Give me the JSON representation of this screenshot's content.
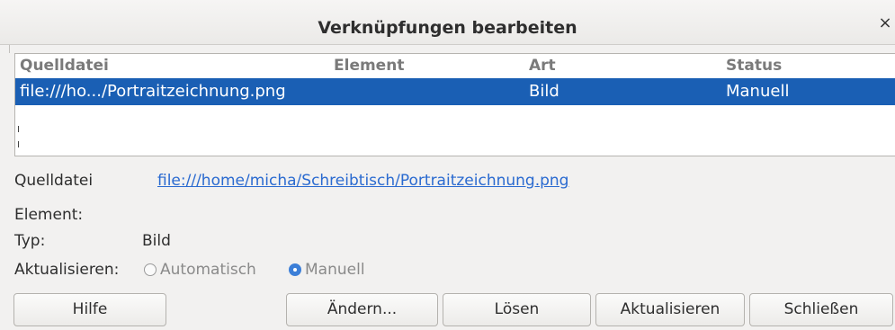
{
  "window": {
    "title": "Verknüpfungen bearbeiten",
    "close_glyph": "×"
  },
  "list": {
    "columns": [
      "Quelldatei",
      "Element",
      "Art",
      "Status"
    ],
    "rows": [
      {
        "source": "file:///ho.../Portraitzeichnung.png",
        "element": "",
        "type": "Bild",
        "status": "Manuell",
        "selected": true
      }
    ]
  },
  "details": {
    "source_label": "Quelldatei",
    "source_value": "file:///home/micha/Schreibtisch/Portraitzeichnung.png",
    "element_label": "Element:",
    "element_value": "",
    "type_label": "Typ:",
    "type_value": "Bild",
    "update_label": "Aktualisieren:",
    "update_options": [
      {
        "label": "Automatisch",
        "selected": false,
        "enabled": false
      },
      {
        "label": "Manuell",
        "selected": true,
        "enabled": false
      }
    ]
  },
  "buttons": {
    "help": "Hilfe",
    "change": "Ändern...",
    "break": "Lösen",
    "update": "Aktualisieren",
    "close": "Schließen"
  },
  "colors": {
    "selection": "#1a5fb4",
    "link": "#2a6ad0",
    "radio_active": "#3c7fd8"
  }
}
